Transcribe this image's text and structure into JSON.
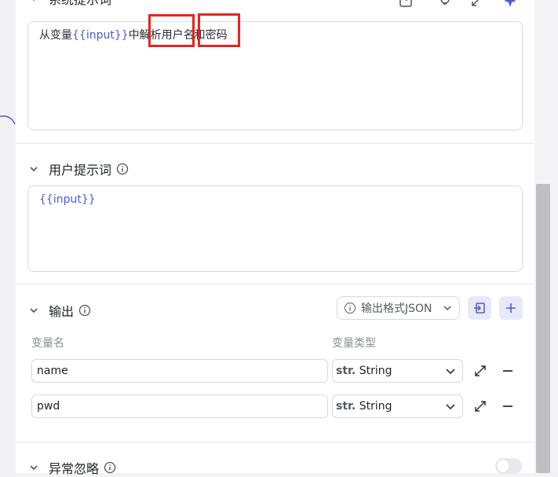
{
  "system_prompt": {
    "title": "系统提示词",
    "text_before": "从变量",
    "variable": "{{input}}",
    "text_after": "中解析用户名和密码"
  },
  "user_prompt": {
    "title": "用户提示词",
    "variable": "{{input}}"
  },
  "output": {
    "title": "输出",
    "format_label": "输出格式JSON",
    "col_var_name": "变量名",
    "col_var_type": "变量类型",
    "rows": [
      {
        "name": "name",
        "type_prefix": "str.",
        "type_name": "String"
      },
      {
        "name": "pwd",
        "type_prefix": "str.",
        "type_name": "String"
      }
    ]
  },
  "exception": {
    "title": "异常忽略",
    "enabled": false
  },
  "colors": {
    "accent": "#4e5bd6",
    "highlight_box": "#e8231c"
  }
}
